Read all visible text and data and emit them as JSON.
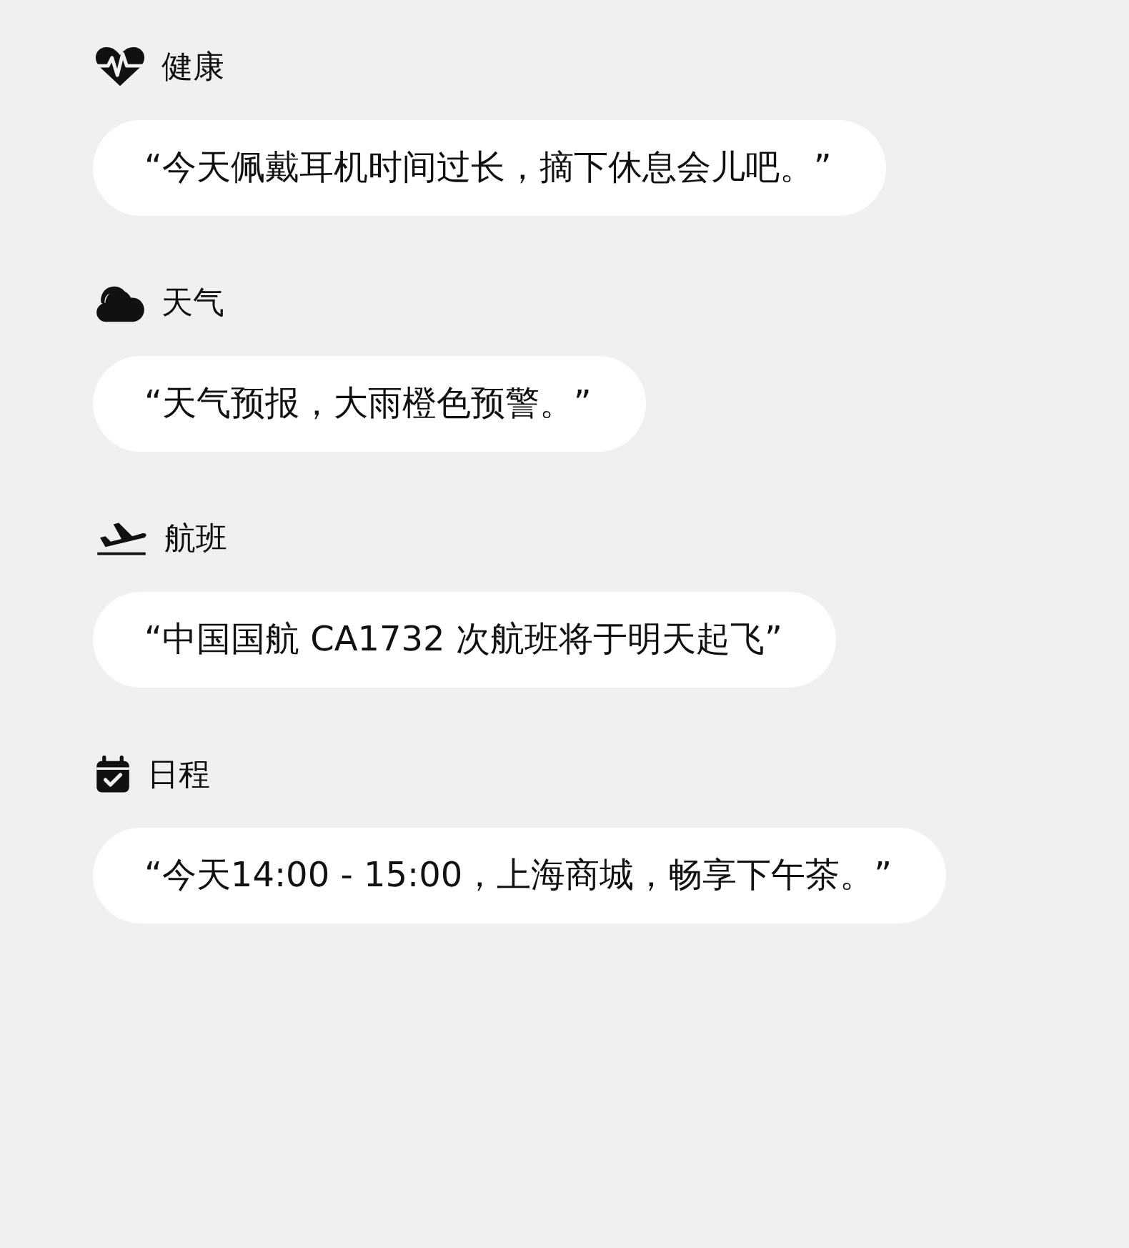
{
  "sections": [
    {
      "kind": "health",
      "title": "健康",
      "quote": "“今天佩戴耳机时间过长，摘下休息会儿吧。”"
    },
    {
      "kind": "weather",
      "title": "天气",
      "quote": "“天气预报，大雨橙色预警。”"
    },
    {
      "kind": "flight",
      "title": "航班",
      "quote": "“中国国航 CA1732 次航班将于明天起飞”"
    },
    {
      "kind": "schedule",
      "title": "日程",
      "quote": "“今天14:00 - 15:00，上海商城，畅享下午茶。”"
    }
  ]
}
